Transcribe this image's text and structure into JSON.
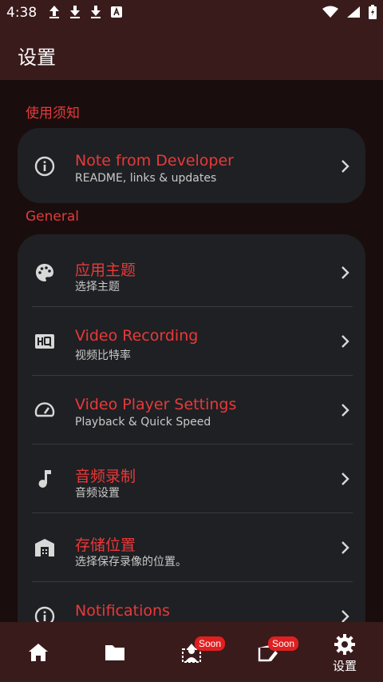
{
  "status_bar": {
    "time": "4:38"
  },
  "app_bar": {
    "title": "设置"
  },
  "sections": [
    {
      "title": "使用须知"
    },
    {
      "title": "General"
    }
  ],
  "developer_card": {
    "title": "Note from Developer",
    "subtitle": "README, links & updates",
    "icon": "info-icon"
  },
  "general_items": [
    {
      "title": "应用主题",
      "subtitle": "选择主题",
      "icon": "palette-icon"
    },
    {
      "title": "Video Recording",
      "subtitle": "视频比特率",
      "icon": "hq-icon"
    },
    {
      "title": "Video Player Settings",
      "subtitle": "Playback & Quick Speed",
      "icon": "speedometer-icon"
    },
    {
      "title": "音频录制",
      "subtitle": "音频设置",
      "icon": "music-note-icon"
    },
    {
      "title": "存储位置",
      "subtitle": "选择保存录像的位置。",
      "icon": "storage-icon"
    },
    {
      "title": "Notifications",
      "subtitle": "",
      "icon": "info-icon"
    }
  ],
  "bottom_nav": {
    "items": [
      {
        "icon": "home-icon"
      },
      {
        "icon": "folder-icon"
      },
      {
        "icon": "photo-person-icon",
        "badge": "Soon"
      },
      {
        "icon": "video-edit-icon",
        "badge": "Soon"
      },
      {
        "icon": "gear-icon",
        "label": "设置"
      }
    ]
  },
  "colors": {
    "accent": "#e8393a",
    "card": "#1f2023",
    "bar": "#3a1b1c",
    "background": "#1a0d0e"
  }
}
